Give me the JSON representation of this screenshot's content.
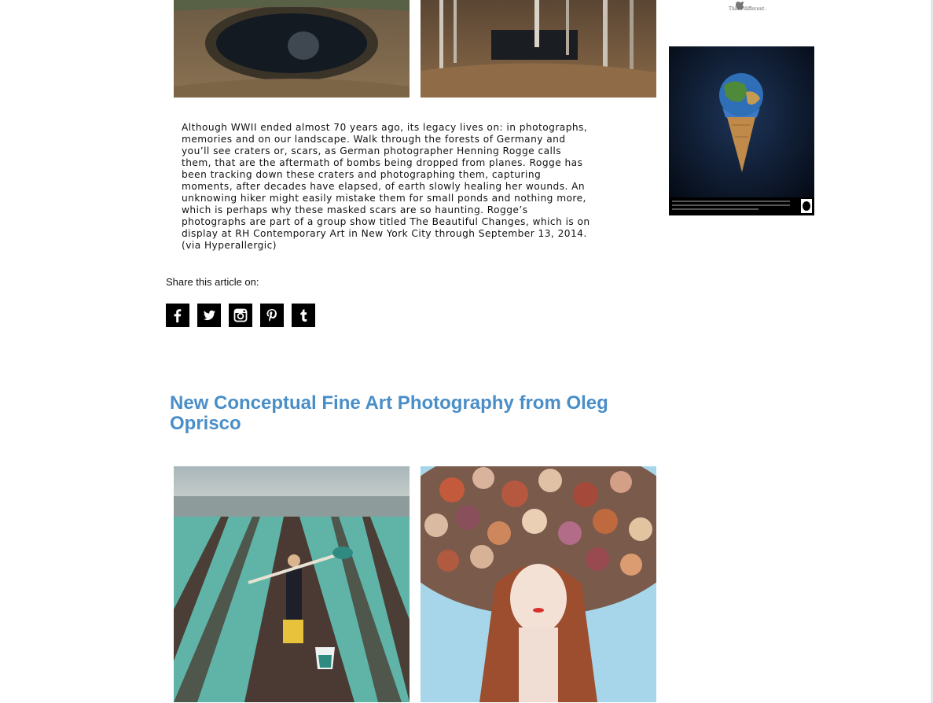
{
  "article": {
    "paragraph": "Although WWII ended almost 70 years ago, its legacy lives on: in photographs, memories and on our landscape. Walk through the forests of Germany and you’ll see craters or, scars, as German photographer Henning Rogge calls them, that are the aftermath of bombs being dropped from planes. Rogge has been tracking down these craters and photographing them, capturing moments, after decades have elapsed, of earth slowly healing her wounds. An unknowing hiker might easily mistake them for small ponds and nothing more, which is perhaps why these masked scars are so haunting. Rogge’s photographs are part of a group show titled The Beautiful Changes, which is on display at RH Contemporary Art in New York City through September 13, 2014. (via Hyperallergic)"
  },
  "share": {
    "label": "Share this article on:",
    "buttons": [
      {
        "network": "Facebook",
        "icon": "facebook-icon"
      },
      {
        "network": "Twitter",
        "icon": "twitter-icon"
      },
      {
        "network": "Instagram",
        "icon": "instagram-icon"
      },
      {
        "network": "Pinterest",
        "icon": "pinterest-icon"
      },
      {
        "network": "Tumblr",
        "icon": "tumblr-icon"
      }
    ]
  },
  "next_post": {
    "title": "New Conceptual Fine Art Photography from Oleg Oprisco"
  },
  "sidebar": {
    "ad_tagline": "Think different."
  },
  "colors": {
    "title_link": "#4a8ec8",
    "text": "#111111",
    "share_button_bg": "#000000"
  }
}
